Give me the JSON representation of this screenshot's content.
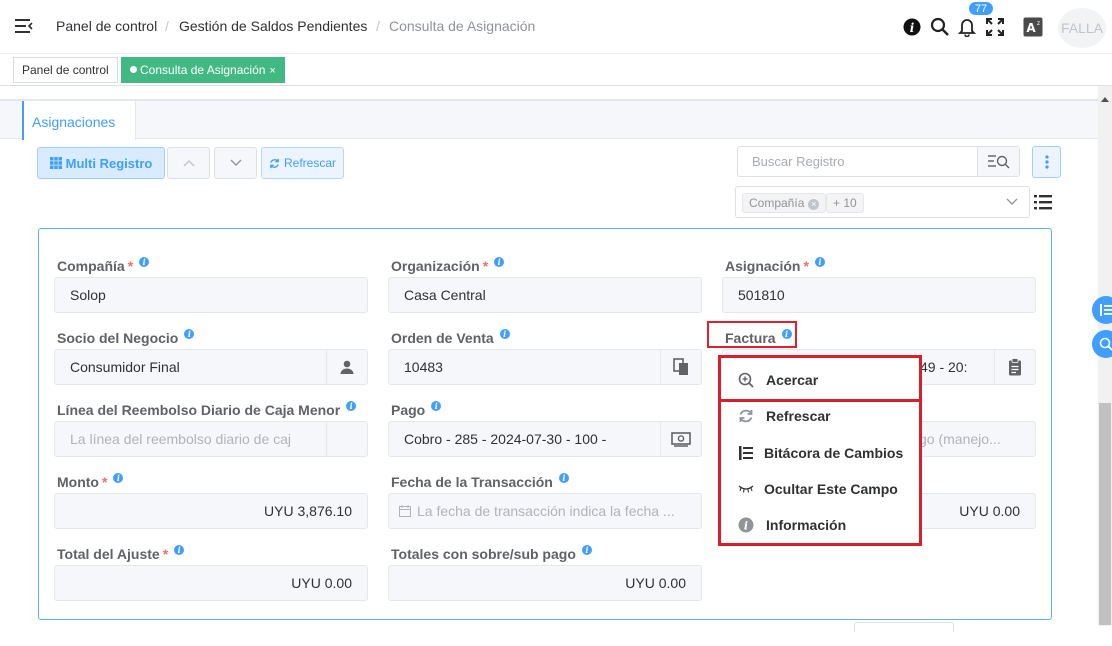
{
  "header": {
    "breadcrumb": [
      "Panel de control",
      "Gestión de Saldos Pendientes",
      "Consulta de Asignación"
    ],
    "separator": "/",
    "notification_count": "77",
    "user_label": "FALLA",
    "icons": [
      "menu-toggle-icon",
      "info-icon",
      "search-icon",
      "bell-icon",
      "fullscreen-icon",
      "font-size-icon"
    ]
  },
  "tabs": {
    "panel": "Panel de control",
    "consulta": "Consulta de Asignación",
    "close": "×"
  },
  "subtab": {
    "label": "Asignaciones"
  },
  "toolbar": {
    "multi_registro": "Multi Registro",
    "refrescar": "Refrescar",
    "search_placeholder": "Buscar Registro",
    "tag_compania": "Compañía",
    "tag_more": "+ 10"
  },
  "form": {
    "compania": {
      "label": "Compañía",
      "value": "Solop"
    },
    "organizacion": {
      "label": "Organización",
      "value": "Casa Central"
    },
    "asignacion": {
      "label": "Asignación",
      "value": "501810"
    },
    "socio": {
      "label": "Socio del Negocio",
      "value": "Consumidor Final"
    },
    "orden_venta": {
      "label": "Orden de Venta",
      "value": "10483"
    },
    "factura": {
      "label": "Factura",
      "value_partial": "49 - 20:"
    },
    "linea_reembolso": {
      "label": "Línea del Reembolso Diario de Caja Menor",
      "placeholder": "La línea del reembolso diario de caj"
    },
    "pago": {
      "label": "Pago",
      "value": "Cobro - 285 - 2024-07-30 - 100 -"
    },
    "cargo_partial": {
      "placeholder_partial": "go (manejo..."
    },
    "monto": {
      "label": "Monto",
      "value": "UYU 3,876.10"
    },
    "fecha": {
      "label": "Fecha de la Transacción",
      "placeholder": "La fecha de transacción indica la fecha ..."
    },
    "right_amount_partial": {
      "value": "UYU 0.00"
    },
    "total_ajuste": {
      "label": "Total del Ajuste",
      "value": "UYU 0.00"
    },
    "totales_sobre": {
      "label": "Totales con sobre/sub pago",
      "value": "UYU 0.00"
    }
  },
  "context_menu": {
    "items": [
      "Acercar",
      "Refrescar",
      "Bitácora de Cambios",
      "Ocultar Este Campo",
      "Información"
    ]
  },
  "colors": {
    "primary": "#409eff",
    "accent_green": "#42b983",
    "required": "#f56c6c",
    "highlight_red": "#d91e2c"
  }
}
